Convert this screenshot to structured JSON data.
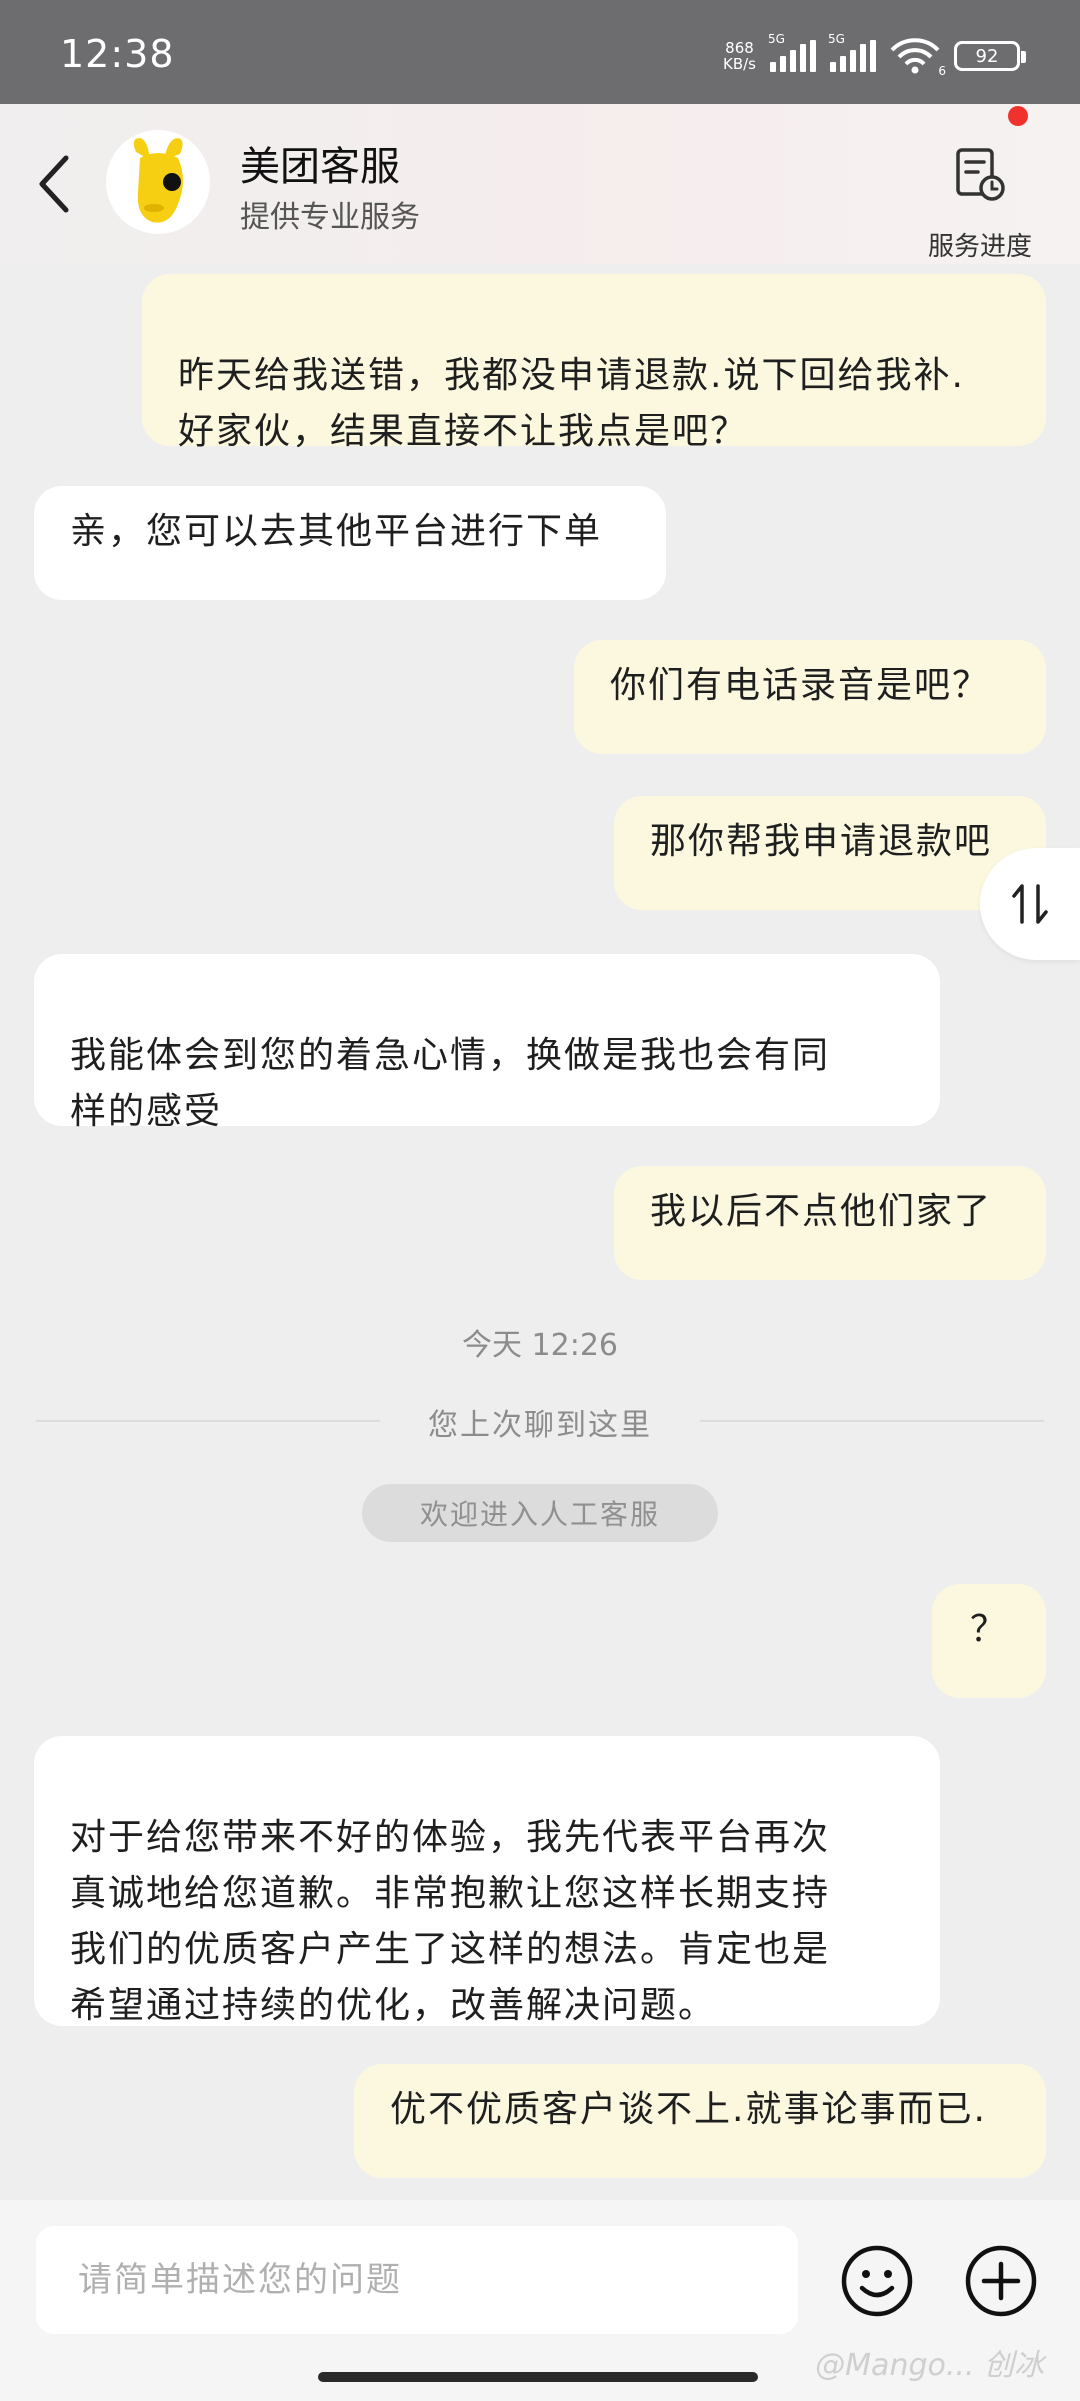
{
  "status_bar": {
    "time": "12:38",
    "net_speed_value": "868",
    "net_speed_unit": "KB/s",
    "signal1_tag": "5G",
    "signal2_tag": "5G",
    "wifi_tag": "6",
    "battery": "92"
  },
  "header": {
    "title": "美团客服",
    "subtitle": "提供专业服务",
    "progress_label": "服务进度"
  },
  "messages": [
    {
      "side": "out",
      "text": "昨天给我送错，我都没申请退款.说下回给我补.\n好家伙，结果直接不让我点是吧？"
    },
    {
      "side": "in",
      "text": "亲，您可以去其他平台进行下单"
    },
    {
      "side": "out",
      "text": "你们有电话录音是吧？"
    },
    {
      "side": "out",
      "text": "那你帮我申请退款吧"
    },
    {
      "side": "in",
      "text": "我能体会到您的着急心情，换做是我也会有同\n样的感受"
    },
    {
      "side": "out",
      "text": "我以后不点他们家了"
    },
    {
      "side": "out",
      "text": "？"
    },
    {
      "side": "in",
      "text": "对于给您带来不好的体验，我先代表平台再次\n真诚地给您道歉。非常抱歉让您这样长期支持\n我们的优质客户产生了这样的想法。肯定也是\n希望通过持续的优化，改善解决问题。"
    },
    {
      "side": "out",
      "text": "优不优质客户谈不上.就事论事而已."
    }
  ],
  "timestamp": "今天 12:26",
  "history_divider": "您上次聊到这里",
  "system_notice": "欢迎进入人工客服",
  "input": {
    "placeholder": "请简单描述您的问题"
  },
  "watermark": "@Mango... 创冰",
  "colors": {
    "outgoing_bubble": "#fcf8df",
    "incoming_bubble": "#ffffff",
    "background": "#eeeeef",
    "notification_dot": "#f0322d",
    "mascot_yellow": "#f7cf12"
  }
}
